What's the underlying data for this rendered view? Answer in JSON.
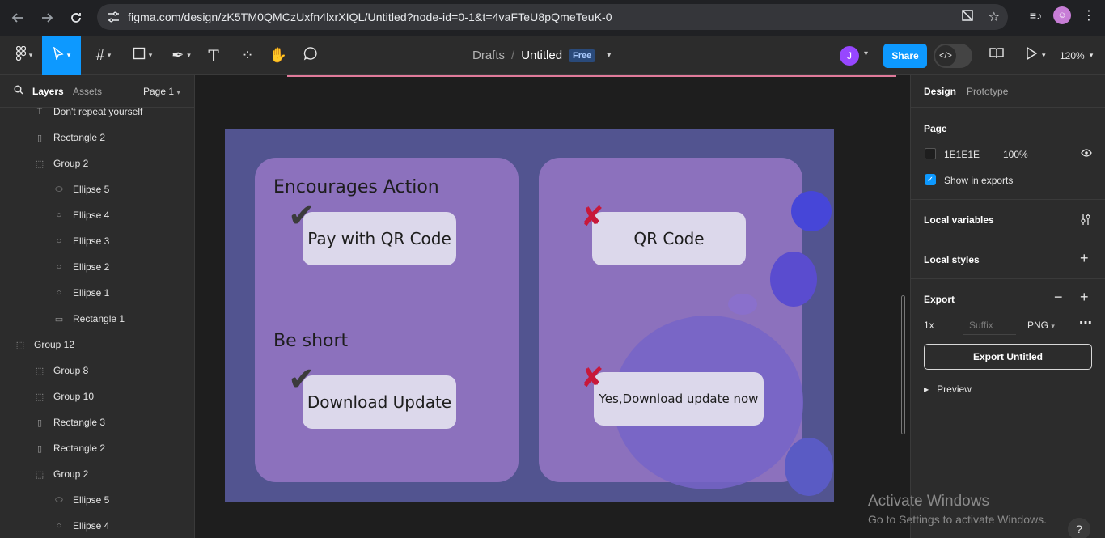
{
  "browser": {
    "url": "figma.com/design/zK5TM0QMCzUxfn4lxrXIQL/Untitled?node-id=0-1&t=4vaFTeU8pQmeTeuK-0",
    "back_icon": "arrow-left",
    "forward_icon": "arrow-right",
    "reload_icon": "reload",
    "profile_initial": "☺"
  },
  "toolbar": {
    "breadcrumb_parent": "Drafts",
    "breadcrumb_sep": "/",
    "file_name": "Untitled",
    "plan_badge": "Free",
    "user_initial": "J",
    "share_label": "Share",
    "zoom_label": "120%"
  },
  "left_panel": {
    "tab_layers": "Layers",
    "tab_assets": "Assets",
    "page_label": "Page 1",
    "layers": [
      {
        "name": "Don't repeat yourself",
        "icon": "T",
        "indent": 1
      },
      {
        "name": "Rectangle 2",
        "icon": "▯",
        "indent": 1
      },
      {
        "name": "Group 2",
        "icon": "⬚",
        "indent": 1
      },
      {
        "name": "Ellipse 5",
        "icon": "⬭",
        "indent": 2
      },
      {
        "name": "Ellipse 4",
        "icon": "○",
        "indent": 2
      },
      {
        "name": "Ellipse 3",
        "icon": "○",
        "indent": 2
      },
      {
        "name": "Ellipse 2",
        "icon": "○",
        "indent": 2
      },
      {
        "name": "Ellipse 1",
        "icon": "○",
        "indent": 2
      },
      {
        "name": "Rectangle 1",
        "icon": "▭",
        "indent": 2
      },
      {
        "name": "Group 12",
        "icon": "⬚",
        "indent": 0
      },
      {
        "name": "Group 8",
        "icon": "⬚",
        "indent": 1
      },
      {
        "name": "Group 10",
        "icon": "⬚",
        "indent": 1
      },
      {
        "name": "Rectangle 3",
        "icon": "▯",
        "indent": 1
      },
      {
        "name": "Rectangle 2",
        "icon": "▯",
        "indent": 1
      },
      {
        "name": "Group 2",
        "icon": "⬚",
        "indent": 1
      },
      {
        "name": "Ellipse 5",
        "icon": "⬭",
        "indent": 2
      },
      {
        "name": "Ellipse 4",
        "icon": "○",
        "indent": 2
      }
    ]
  },
  "canvas": {
    "left_card": {
      "heading1": "Encourages Action",
      "button1": "Pay with QR Code",
      "heading2": "Be short",
      "button2": "Download Update",
      "mark": "✔"
    },
    "right_card": {
      "button1": "QR Code",
      "button2": "Yes,Download update now",
      "mark": "✘"
    }
  },
  "right_panel": {
    "tab_design": "Design",
    "tab_prototype": "Prototype",
    "page_title": "Page",
    "page_color_hex": "1E1E1E",
    "page_opacity": "100%",
    "show_in_exports": "Show in exports",
    "local_variables": "Local variables",
    "local_styles": "Local styles",
    "export_title": "Export",
    "export_scale": "1x",
    "export_suffix_placeholder": "Suffix",
    "export_format": "PNG",
    "export_button": "Export Untitled",
    "preview_label": "Preview"
  },
  "watermark": {
    "title": "Activate Windows",
    "subtitle": "Go to Settings to activate Windows."
  },
  "colors": {
    "accent": "#0d99ff",
    "frame_bg": "#525490",
    "card_bg": "#8c71bd",
    "check_color": "#3b3b3b",
    "cross_color": "#c8183a"
  }
}
